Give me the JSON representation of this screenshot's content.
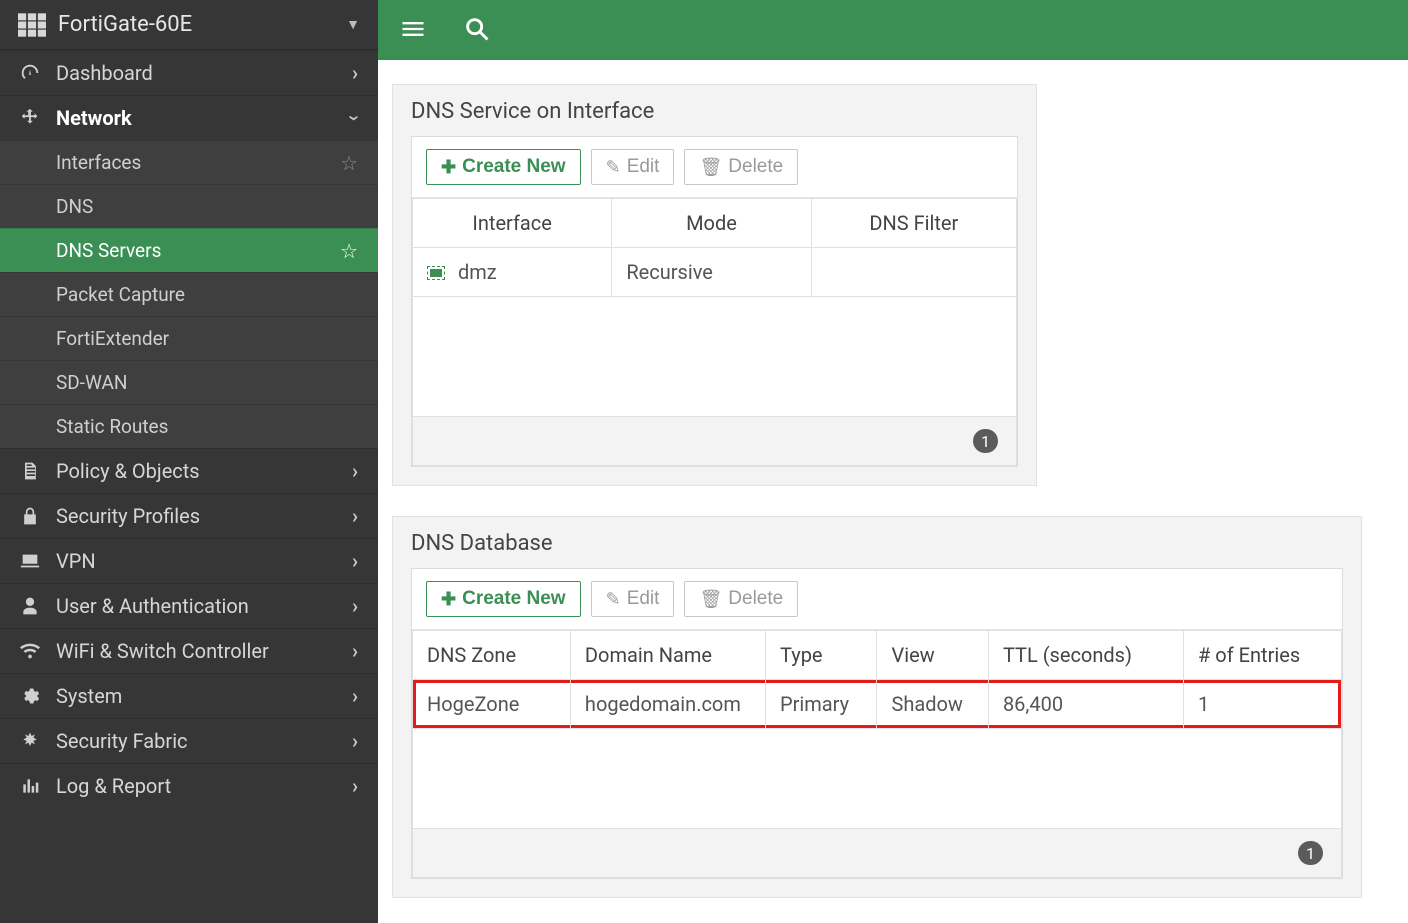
{
  "brand": "FortiGate-60E",
  "sidebar": {
    "dashboard": "Dashboard",
    "network": "Network",
    "network_items": {
      "interfaces": "Interfaces",
      "dns": "DNS",
      "dns_servers": "DNS Servers",
      "packet_capture": "Packet Capture",
      "fortiextender": "FortiExtender",
      "sdwan": "SD-WAN",
      "static_routes": "Static Routes"
    },
    "policy": "Policy & Objects",
    "security": "Security Profiles",
    "vpn": "VPN",
    "user": "User & Authentication",
    "wifi": "WiFi & Switch Controller",
    "system": "System",
    "fabric": "Security Fabric",
    "log": "Log & Report"
  },
  "buttons": {
    "create": "Create New",
    "edit": "Edit",
    "delete": "Delete"
  },
  "service_panel": {
    "title": "DNS Service on Interface",
    "cols": {
      "interface": "Interface",
      "mode": "Mode",
      "filter": "DNS Filter"
    },
    "row": {
      "interface": "dmz",
      "mode": "Recursive",
      "filter": ""
    },
    "count": "1"
  },
  "db_panel": {
    "title": "DNS Database",
    "cols": {
      "zone": "DNS Zone",
      "domain": "Domain Name",
      "type": "Type",
      "view": "View",
      "ttl": "TTL (seconds)",
      "entries": "# of Entries"
    },
    "row": {
      "zone": "HogeZone",
      "domain": "hogedomain.com",
      "type": "Primary",
      "view": "Shadow",
      "ttl": "86,400",
      "entries": "1"
    },
    "count": "1"
  }
}
